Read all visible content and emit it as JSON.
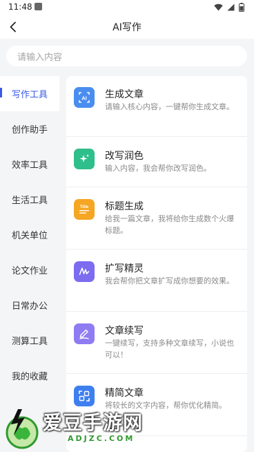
{
  "status_bar": {
    "time": "11:48"
  },
  "header": {
    "title": "AI写作"
  },
  "search": {
    "placeholder": "请输入内容"
  },
  "sidebar": {
    "items": [
      {
        "label": "写作工具",
        "active": true
      },
      {
        "label": "创作助手"
      },
      {
        "label": "效率工具"
      },
      {
        "label": "生活工具"
      },
      {
        "label": "机关单位"
      },
      {
        "label": "论文作业"
      },
      {
        "label": "日常办公"
      },
      {
        "label": "测算工具"
      },
      {
        "label": "我的收藏"
      }
    ]
  },
  "tools": [
    {
      "title": "生成文章",
      "desc": "请输入核心内容，一键帮你生成文章。",
      "icon": "ai-article-icon",
      "color": "#4a8df0"
    },
    {
      "title": "改写润色",
      "desc": "输入内容，我会帮你改写润色。",
      "icon": "sparkle-icon",
      "color": "#2fbf8a"
    },
    {
      "title": "标题生成",
      "desc": "给我一篇文章，我将给你生成数个火爆标题。",
      "icon": "title-icon",
      "color": "#f5a623"
    },
    {
      "title": "扩写精灵",
      "desc": "我会帮你把文章扩写成你想要的效果。",
      "icon": "handwriting-icon",
      "color": "#7b6cf0"
    },
    {
      "title": "文章续写",
      "desc": "一键续写，支持多种文章续写，小说也可以！",
      "icon": "pen-icon",
      "color": "#8f7cf2"
    },
    {
      "title": "精简文章",
      "desc": "将较长的文字内容，帮你优化精简。",
      "icon": "condense-icon",
      "color": "#3e7ff0"
    }
  ],
  "watermark": {
    "text": "爱豆手游网",
    "domain": "ADJZC.COM"
  }
}
